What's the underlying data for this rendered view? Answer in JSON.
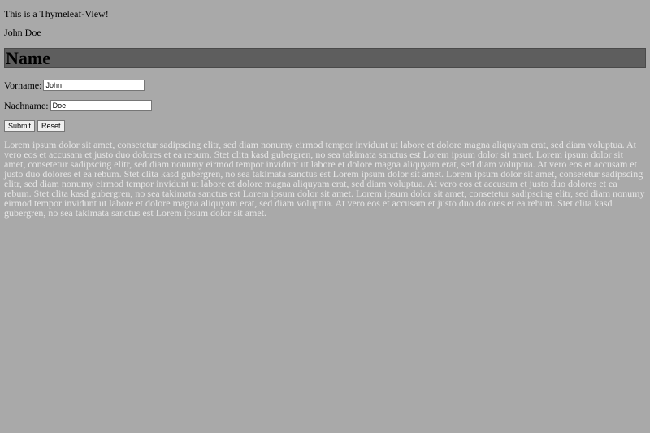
{
  "intro_text": "This is a Thymeleaf-View!",
  "user_name": "John Doe",
  "section": {
    "title": "Name"
  },
  "form": {
    "first_name": {
      "label": "Vorname:",
      "value": "John"
    },
    "last_name": {
      "label": "Nachname:",
      "value": "Doe"
    },
    "submit_label": "Submit",
    "reset_label": "Reset"
  },
  "lorem_text": "Lorem ipsum dolor sit amet, consetetur sadipscing elitr, sed diam nonumy eirmod tempor invidunt ut labore et dolore magna aliquyam erat, sed diam voluptua. At vero eos et accusam et justo duo dolores et ea rebum. Stet clita kasd gubergren, no sea takimata sanctus est Lorem ipsum dolor sit amet. Lorem ipsum dolor sit amet, consetetur sadipscing elitr, sed diam nonumy eirmod tempor invidunt ut labore et dolore magna aliquyam erat, sed diam voluptua. At vero eos et accusam et justo duo dolores et ea rebum. Stet clita kasd gubergren, no sea takimata sanctus est Lorem ipsum dolor sit amet. Lorem ipsum dolor sit amet, consetetur sadipscing elitr, sed diam nonumy eirmod tempor invidunt ut labore et dolore magna aliquyam erat, sed diam voluptua. At vero eos et accusam et justo duo dolores et ea rebum. Stet clita kasd gubergren, no sea takimata sanctus est Lorem ipsum dolor sit amet. Lorem ipsum dolor sit amet, consetetur sadipscing elitr, sed diam nonumy eirmod tempor invidunt ut labore et dolore magna aliquyam erat, sed diam voluptua. At vero eos et accusam et justo duo dolores et ea rebum. Stet clita kasd gubergren, no sea takimata sanctus est Lorem ipsum dolor sit amet.",
  "colors": {
    "page_background": "#a9a9a9",
    "header_background": "#5e5e5e",
    "lorem_text": "#e6e6e6"
  }
}
